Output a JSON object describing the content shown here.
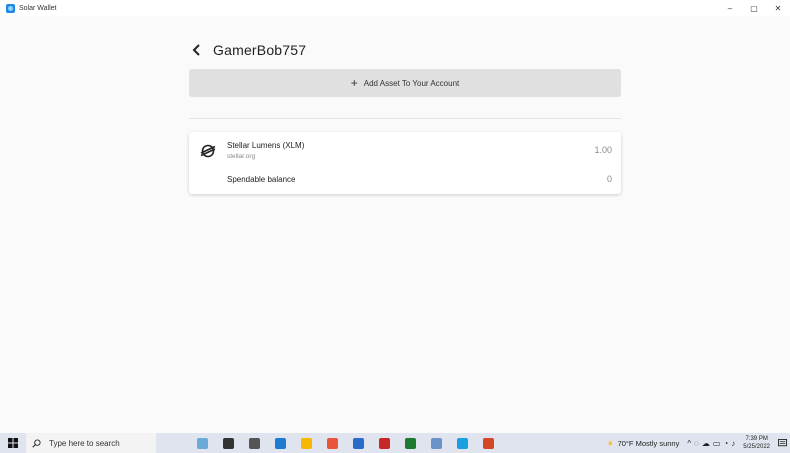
{
  "window": {
    "title": "Solar Wallet",
    "controls": {
      "minimize": "–",
      "maximize": "▢",
      "close": "✕"
    }
  },
  "header": {
    "account_name": "GamerBob757"
  },
  "add_asset": {
    "label": "Add Asset To Your Account"
  },
  "asset": {
    "name": "Stellar Lumens (XLM)",
    "domain": "stellar.org",
    "balance": "1.00",
    "spendable_label": "Spendable balance",
    "spendable_value": "0"
  },
  "taskbar": {
    "search_placeholder": "Type here to search",
    "weather": "70°F  Mostly sunny",
    "time": "7:39 PM",
    "date": "5/25/2022",
    "app_colors": [
      "#6aaad8",
      "#333333",
      "#555555",
      "#1f7bd1",
      "#f5b700",
      "#e9543b",
      "#2a6ac8",
      "#c62828",
      "#1b7a2f",
      "#6b93c9",
      "#1aa0e0",
      "#d24726"
    ]
  },
  "colors": {
    "accent": "#1e88e5",
    "button_bg": "#e0e0e0",
    "background": "#fafafa"
  }
}
